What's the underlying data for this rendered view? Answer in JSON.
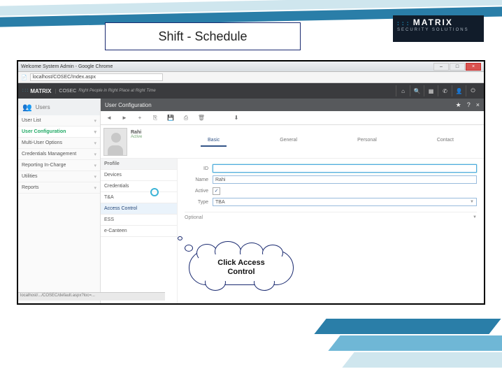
{
  "slide": {
    "title": "Shift - Schedule"
  },
  "logoblock": {
    "brand": "MATRIX",
    "dots": ": : :",
    "sub": "SECURITY SOLUTIONS"
  },
  "browser": {
    "window_title": "Welcome System Admin - Google Chrome",
    "min": "–",
    "max": "□",
    "close": "×",
    "url": "localhost/COSEC/Index.aspx"
  },
  "app": {
    "brand_dots": ": : :",
    "brand_name": "MATRIX",
    "product": "COSEC",
    "tagline": "Right People in Right Place at Right Time",
    "icons": {
      "home": "⌂",
      "search": "🔍",
      "grid": "▦",
      "phone": "✆",
      "user": "👤",
      "power": "⏻"
    }
  },
  "leftnav": {
    "header": "Users",
    "items": [
      {
        "label": "User List"
      },
      {
        "label": "User Configuration"
      },
      {
        "label": "Multi-User Options"
      },
      {
        "label": "Credentials Management"
      },
      {
        "label": "Reporting In-Charge"
      },
      {
        "label": "Utilities"
      },
      {
        "label": "Reports"
      }
    ]
  },
  "modal": {
    "title": "User Configuration",
    "actions": {
      "star": "★",
      "help": "?",
      "close": "×"
    }
  },
  "toolbar": {
    "prev": "◄",
    "next": "►",
    "add": "+",
    "copy": "⎘",
    "save": "💾",
    "print": "⎙",
    "del": "🗑",
    "down": "⬇"
  },
  "user": {
    "name": "Rahi",
    "status": "Active"
  },
  "tabs": [
    {
      "label": "Basic",
      "selected": true
    },
    {
      "label": "General"
    },
    {
      "label": "Personal"
    },
    {
      "label": "Contact"
    }
  ],
  "sublist": {
    "head": "Profile",
    "items": [
      {
        "label": "Devices"
      },
      {
        "label": "Credentials"
      },
      {
        "label": "T&A"
      },
      {
        "label": "Access Control",
        "selected": true
      },
      {
        "label": "ESS"
      },
      {
        "label": "e-Canteen"
      }
    ]
  },
  "form": {
    "id_label": "ID",
    "id_value": "",
    "name_label": "Name",
    "name_value": "Rahi",
    "active_label": "Active",
    "active_check": "✓",
    "type_label": "Type",
    "type_value": "TBA",
    "optional_header": "Optional"
  },
  "callout": {
    "line1": "Click Access",
    "line2": "Control"
  },
  "status_url": "localhost/.../COSEC/default.aspx?loc=..."
}
